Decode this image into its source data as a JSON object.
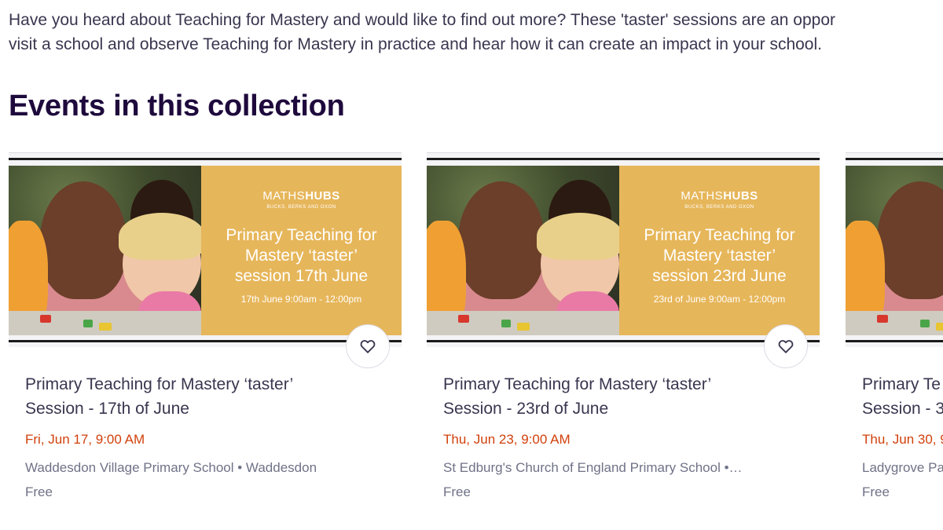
{
  "intro": {
    "line1": "Have you heard about Teaching for Mastery and would like to find out more? These 'taster' sessions are an oppor",
    "line2": "visit a school and observe Teaching for Mastery in practice and hear how it can create an impact in your school."
  },
  "section_title": "Events in this collection",
  "colors": {
    "heading": "#1e0a3c",
    "text": "#39364f",
    "date": "#d1410c",
    "muted": "#6f7287",
    "banner_panel": "#e6b65a"
  },
  "events": [
    {
      "banner": {
        "logo_light": "MATHS",
        "logo_bold": "HUBS",
        "logo_sub": "BUCKS, BERKS AND OXON",
        "line1": "Primary Teaching for",
        "line2": "Mastery ‘taster’",
        "line3": "session 17th June",
        "sub": "17th June 9:00am - 12:00pm"
      },
      "title_line1": "Primary Teaching for Mastery ‘taster’",
      "title_line2": "Session - 17th of June",
      "date": "Fri, Jun 17, 9:00 AM",
      "location": "Waddesdon Village Primary School • Waddesdon",
      "price": "Free",
      "favorite_icon": "heart-icon"
    },
    {
      "banner": {
        "logo_light": "MATHS",
        "logo_bold": "HUBS",
        "logo_sub": "BUCKS, BERKS AND OXON",
        "line1": "Primary Teaching for",
        "line2": "Mastery ‘taster’",
        "line3": "session 23rd June",
        "sub": "23rd of June 9:00am - 12:00pm"
      },
      "title_line1": "Primary Teaching for Mastery ‘taster’",
      "title_line2": "Session - 23rd of June",
      "date": "Thu, Jun 23, 9:00 AM",
      "location": "St Edburg's Church of England Primary School •…",
      "price": "Free",
      "favorite_icon": "heart-icon"
    },
    {
      "title_line1": "Primary Te",
      "title_line2": "Session - 3",
      "date": "Thu, Jun 30, 9",
      "location": "Ladygrove Pa",
      "price": "Free"
    }
  ]
}
